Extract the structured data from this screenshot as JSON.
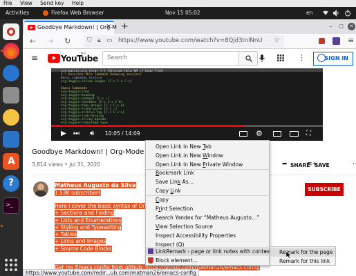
{
  "app_menu": [
    "File",
    "View",
    "Send key",
    "Help"
  ],
  "topbar": {
    "activities": "Activities",
    "app_name": "Firefox Web Browser",
    "clock": "Nov 15  05:02",
    "input_source": "en"
  },
  "tab": {
    "title": "Goodbye Markdown! | Org-M"
  },
  "url": "https://www.youtube.com/watch?v=8Qjd3tnlNnU",
  "youtube": {
    "logo_text": "YouTube",
    "region": "RU",
    "search_placeholder": "Search",
    "sign_in": "SIGN IN"
  },
  "video": {
    "time": "10:05 / 14:09",
    "progress_fraction": 0.712,
    "title": "Goodbye Markdown! | Org-Mode Tutorial",
    "meta": "3,814 views • Jul 31, 2020",
    "share": "SHARE",
    "save": "SAVE",
    "code_lines": [
      "org-basics.org [org] [-] [Unicode Helm WK ↑] Undo-Tree]",
      "C-: Describe this command (keeping session)",
      "Basic commands history",
      "  org-toggle-inline-images [C-c C-x C-v]",
      "",
      "Emacs Commands",
      "  org-toggle-item",
      "  org-toggle-heading",
      "  org-toggle-comment [C-c ;]",
      "  org-toggle-checkbox [C-c C-x C-b]",
      "  org-toggle-tags-groups [C-c C-x q]",
      "  org-toggle-fixed-width [C-c :]",
      "  org-toggle-archive-tag [C-c C-x a]",
      "  org-toggle-link-display",
      "  org-toggle-sticky-agenda",
      "  org-toggle-timestamp-type"
    ]
  },
  "channel": {
    "name": "Matheus Augusto da Silva",
    "subscribers": "1.53K subscribers",
    "subscribe": "SUBSCRIBE",
    "description": [
      "Here I cover the basic syntax of Org files:",
      "+ Sections and Folding",
      "+ Lists and Enumerations",
      "+ Styling and Typesetting",
      "+ Tables",
      "+ Links and Images",
      "+ Source Code Blocks"
    ],
    "config_text": "Get my Emacs config from github: https://github.com/matman26/emacs-config"
  },
  "status_url": "https://www.youtube.com/redir...ub.com/matman26/emacs-config",
  "context_menu": {
    "items": [
      {
        "pre": "Open Link in New ",
        "key": "T",
        "post": "ab"
      },
      {
        "pre": "Open Link in New ",
        "key": "W",
        "post": "indow"
      },
      {
        "pre": "Open Link in New ",
        "key": "P",
        "post": "rivate Window"
      },
      {
        "pre": "",
        "key": "B",
        "post": "ookmark Link"
      },
      {
        "pre": "Save Lin",
        "key": "k",
        "post": " As…"
      },
      {
        "pre": "Copy ",
        "key": "L",
        "post": "ink"
      },
      {
        "pre": "",
        "key": "C",
        "post": "opy"
      },
      {
        "pre": "P",
        "key": "r",
        "post": "int Selection"
      },
      {
        "pre": "Search Yandex for “Matheus Augusto…”",
        "key": "",
        "post": ""
      },
      {
        "pre": "",
        "key": "V",
        "post": "iew Selection Source"
      },
      {
        "pre": "Inspect Accessibility Properties",
        "key": "",
        "post": ""
      },
      {
        "pre": "Inspect (",
        "key": "Q",
        "post": ")"
      },
      {
        "pre": "LinkRemark - page or link notes with context",
        "key": "",
        "post": ""
      },
      {
        "pre": "Block element...",
        "key": "",
        "post": ""
      }
    ],
    "submenu": [
      "Remark for the page",
      "Remark for this link"
    ]
  },
  "colors": {
    "accent": "#e95420",
    "youtube_red": "#ff0000",
    "subscribe_red": "#cc0000",
    "link_blue": "#065fd4"
  }
}
